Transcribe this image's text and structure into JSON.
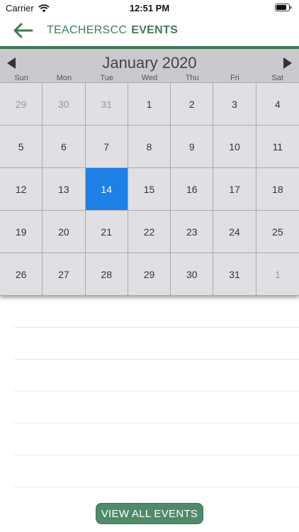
{
  "status_bar": {
    "carrier": "Carrier",
    "time": "12:51 PM"
  },
  "header": {
    "org": "TEACHERSCC",
    "section": "EVENTS",
    "accent_color": "#3d7a56"
  },
  "calendar": {
    "month_label": "January 2020",
    "weekdays": [
      "Sun",
      "Mon",
      "Tue",
      "Wed",
      "Thu",
      "Fri",
      "Sat"
    ],
    "selected_day": "14",
    "selected_color": "#1e80e6",
    "weeks": [
      [
        {
          "label": "29",
          "outside": true
        },
        {
          "label": "30",
          "outside": true
        },
        {
          "label": "31",
          "outside": true
        },
        {
          "label": "1",
          "outside": false
        },
        {
          "label": "2",
          "outside": false
        },
        {
          "label": "3",
          "outside": false
        },
        {
          "label": "4",
          "outside": false
        }
      ],
      [
        {
          "label": "5",
          "outside": false
        },
        {
          "label": "6",
          "outside": false
        },
        {
          "label": "7",
          "outside": false
        },
        {
          "label": "8",
          "outside": false
        },
        {
          "label": "9",
          "outside": false
        },
        {
          "label": "10",
          "outside": false
        },
        {
          "label": "11",
          "outside": false
        }
      ],
      [
        {
          "label": "12",
          "outside": false
        },
        {
          "label": "13",
          "outside": false
        },
        {
          "label": "14",
          "outside": false,
          "selected": true
        },
        {
          "label": "15",
          "outside": false
        },
        {
          "label": "16",
          "outside": false
        },
        {
          "label": "17",
          "outside": false
        },
        {
          "label": "18",
          "outside": false
        }
      ],
      [
        {
          "label": "19",
          "outside": false
        },
        {
          "label": "20",
          "outside": false
        },
        {
          "label": "21",
          "outside": false
        },
        {
          "label": "22",
          "outside": false
        },
        {
          "label": "23",
          "outside": false
        },
        {
          "label": "24",
          "outside": false
        },
        {
          "label": "25",
          "outside": false
        }
      ],
      [
        {
          "label": "26",
          "outside": false
        },
        {
          "label": "27",
          "outside": false
        },
        {
          "label": "28",
          "outside": false
        },
        {
          "label": "29",
          "outside": false
        },
        {
          "label": "30",
          "outside": false
        },
        {
          "label": "31",
          "outside": false
        },
        {
          "label": "1",
          "outside": true
        }
      ]
    ]
  },
  "event_list": {
    "empty_rows": 6
  },
  "footer": {
    "view_all_label": "VIEW ALL EVENTS",
    "button_color": "#4f8a6a"
  }
}
